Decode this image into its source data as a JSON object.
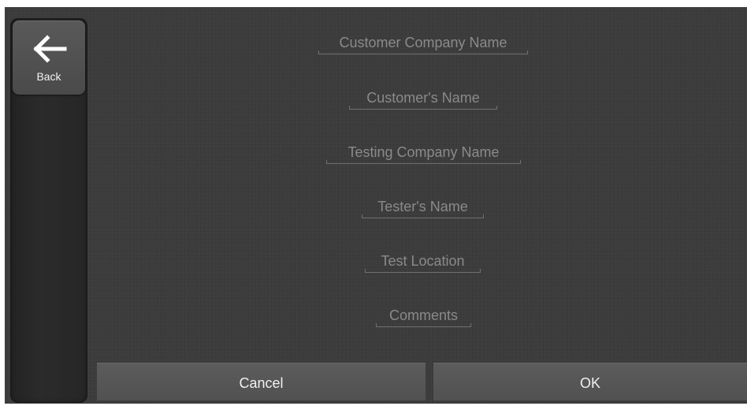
{
  "sidebar": {
    "back_label": "Back",
    "back_icon": "arrow-left-icon"
  },
  "form": {
    "fields": [
      {
        "placeholder": "Customer Company Name",
        "value": ""
      },
      {
        "placeholder": "Customer's Name",
        "value": ""
      },
      {
        "placeholder": "Testing Company Name",
        "value": ""
      },
      {
        "placeholder": "Tester's Name",
        "value": ""
      },
      {
        "placeholder": "Test Location",
        "value": ""
      },
      {
        "placeholder": "Comments",
        "value": ""
      }
    ]
  },
  "actions": {
    "cancel_label": "Cancel",
    "ok_label": "OK"
  },
  "colors": {
    "background": "#3b3b3b",
    "placeholder_text": "#8a8a8a",
    "button_text": "#f0f0f0"
  }
}
